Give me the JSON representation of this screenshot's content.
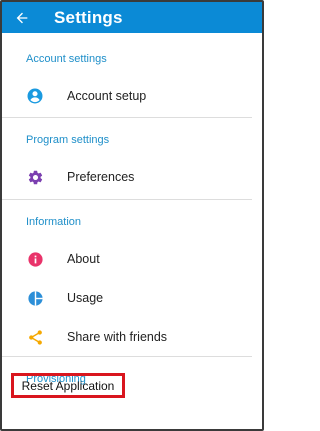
{
  "appbar": {
    "title": "Settings",
    "back_icon": "arrow-left-icon",
    "color": "#0b8ad6"
  },
  "sections": {
    "account": {
      "header": "Account settings",
      "items": [
        {
          "label": "Account setup",
          "icon": "account-circle-icon",
          "icon_color": "#1a9ae0"
        }
      ]
    },
    "program": {
      "header": "Program settings",
      "items": [
        {
          "label": "Preferences",
          "icon": "gear-icon",
          "icon_color": "#7b3fb0"
        }
      ]
    },
    "information": {
      "header": "Information",
      "items": [
        {
          "label": "About",
          "icon": "info-icon",
          "icon_color": "#e9336a"
        },
        {
          "label": "Usage",
          "icon": "pie-chart-icon",
          "icon_color": "#2c8fd8"
        },
        {
          "label": "Share with friends",
          "icon": "share-icon",
          "icon_color": "#f5a800"
        }
      ]
    },
    "provisioning": {
      "header": "Provisioning",
      "items": [
        {
          "label": "Reset Application",
          "highlight_color": "#d9161e"
        }
      ]
    }
  },
  "header_color": "#1f8fc9"
}
